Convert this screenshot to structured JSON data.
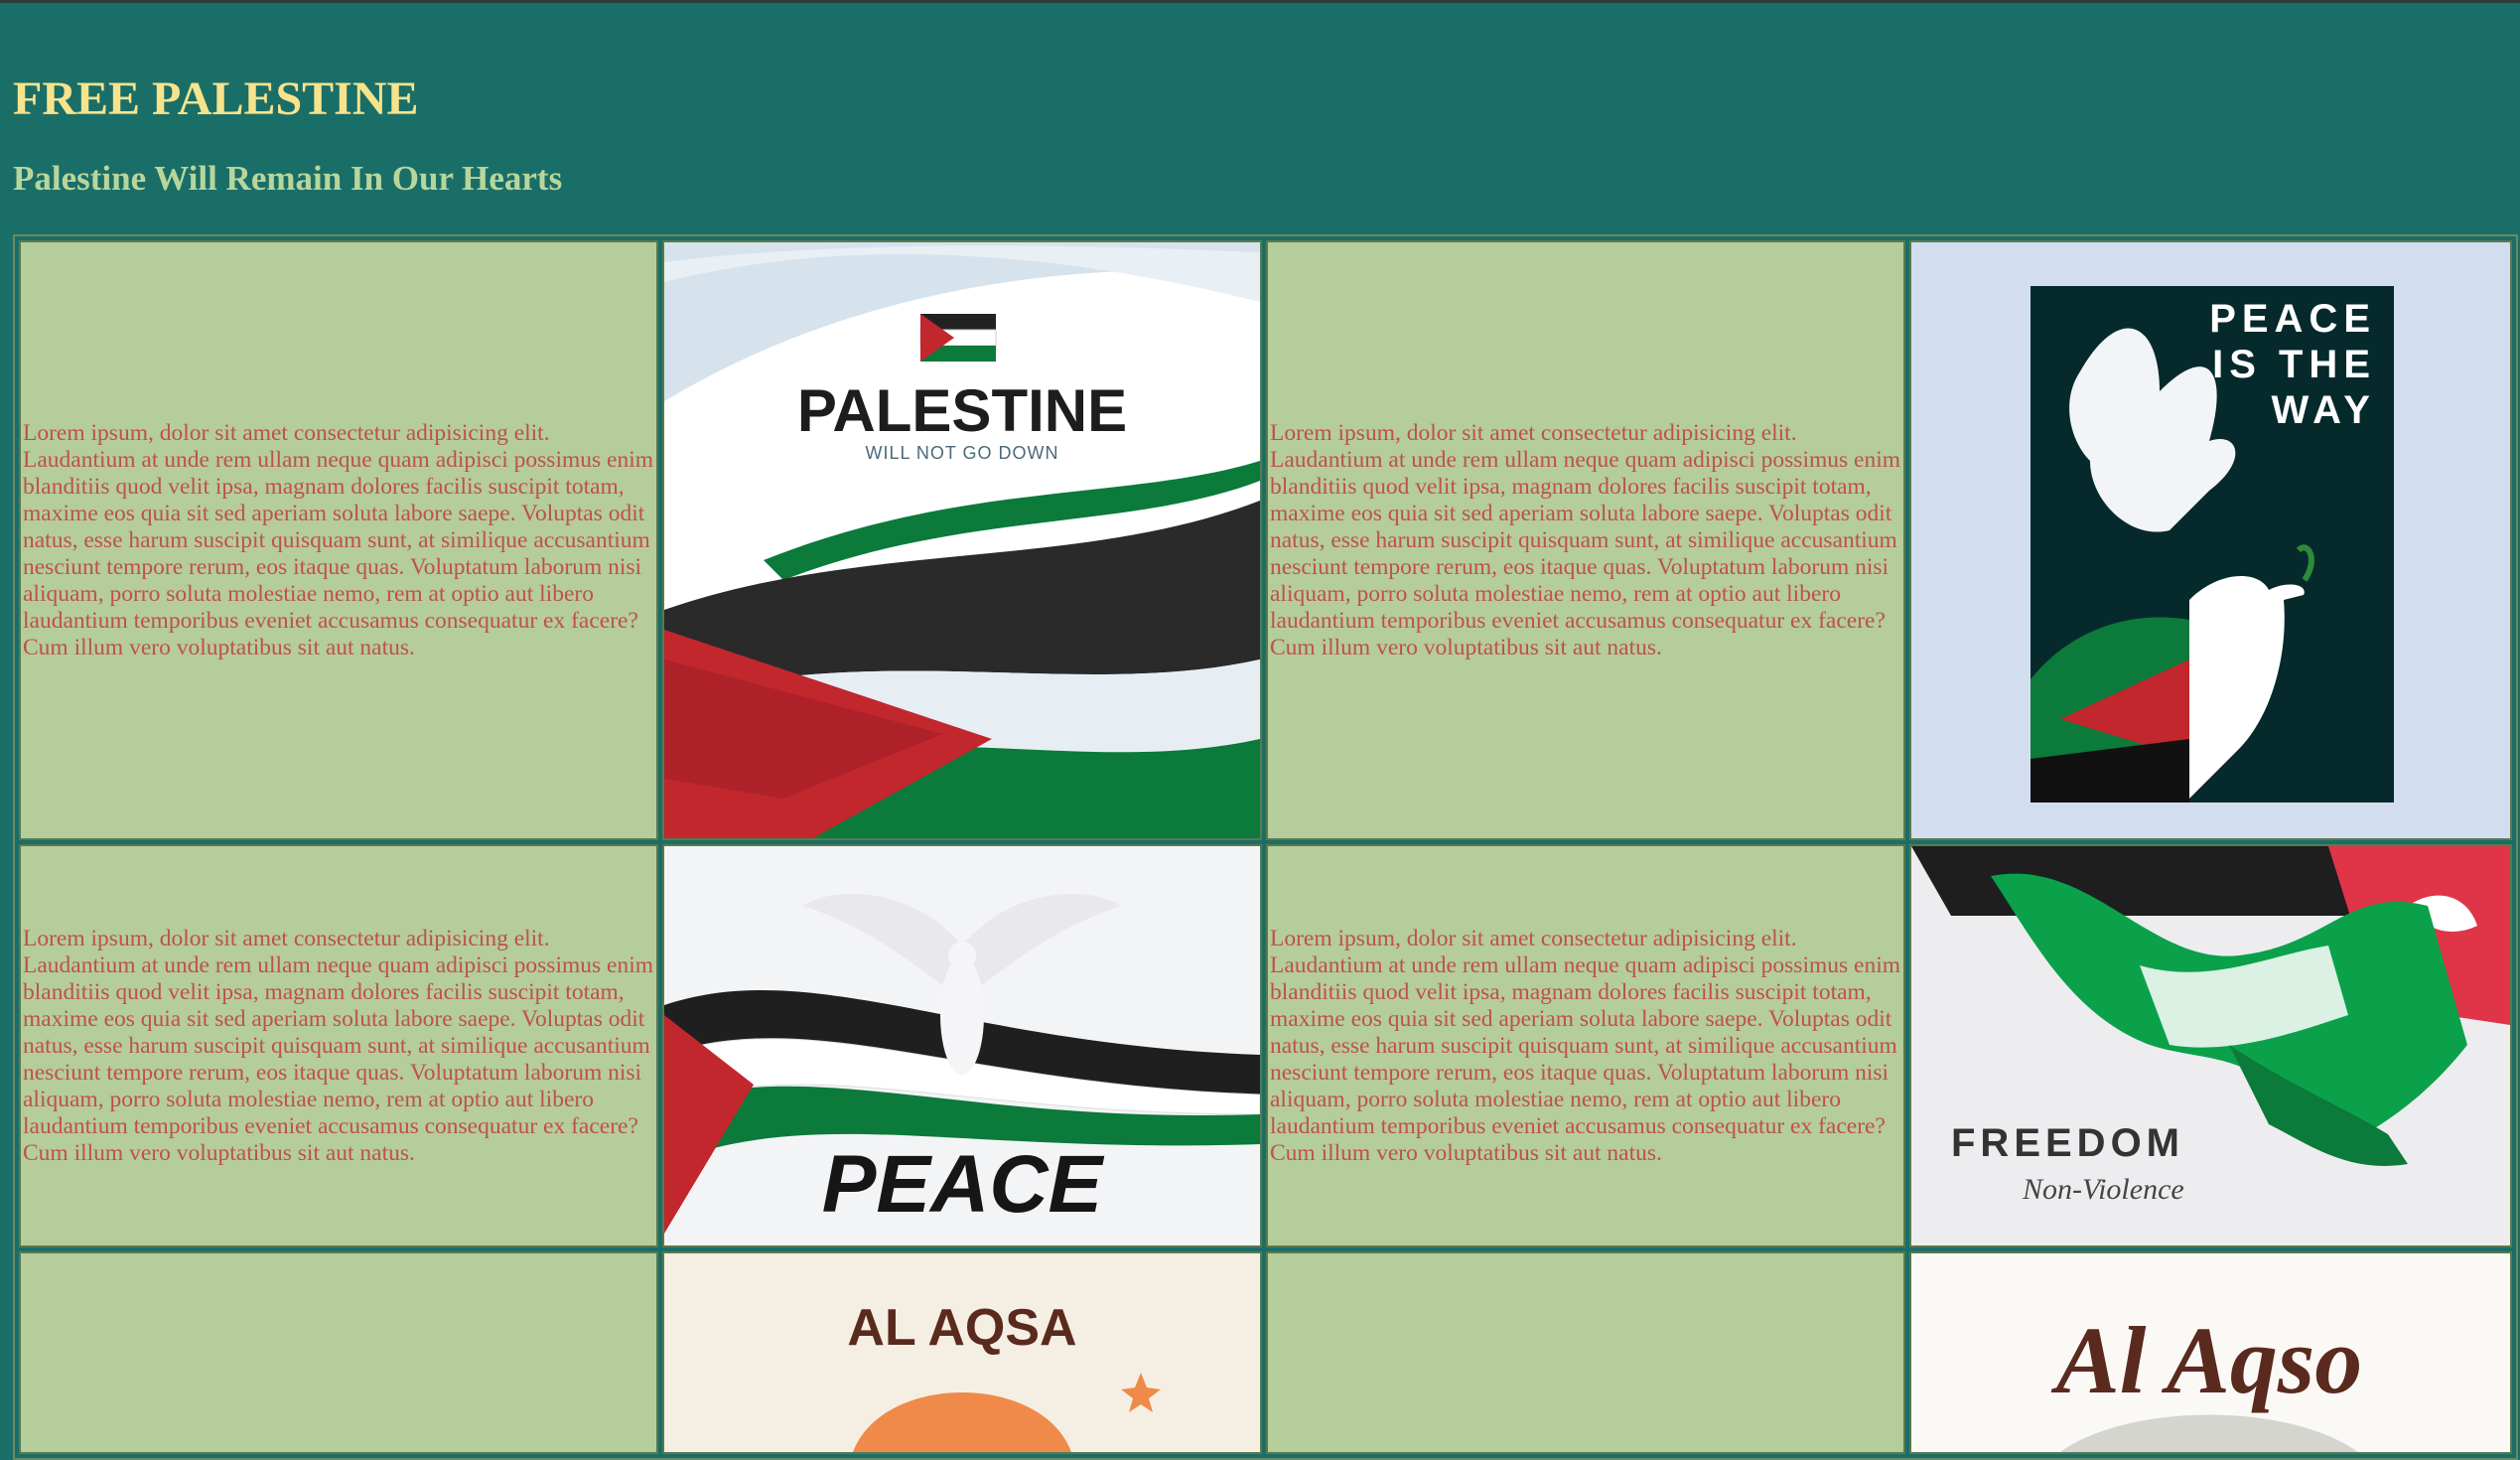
{
  "header": {
    "title": "FREE PALESTINE",
    "subtitle": "Palestine Will Remain In Our Hearts"
  },
  "lorem": "Lorem ipsum, dolor sit amet consectetur adipisicing elit. Laudantium at unde rem ullam neque quam adipisci possimus enim blanditiis quod velit ipsa, magnam dolores facilis suscipit totam, maxime eos quia sit sed aperiam soluta labore saepe. Voluptas odit natus, esse harum suscipit quisquam sunt, at similique accusantium nesciunt tempore rerum, eos itaque quas. Voluptatum laborum nisi aliquam, porro soluta molestiae nemo, rem at optio aut libero laudantium temporibus eveniet accusamus consequatur ex facere? Cum illum vero voluptatibus sit aut natus.",
  "posters": {
    "palestine": {
      "title": "PALESTINE",
      "tagline": "WILL NOT GO DOWN"
    },
    "peace_way": {
      "line1": "PEACE",
      "line2": "IS THE",
      "line3": "WAY"
    },
    "peace": {
      "title": "PEACE"
    },
    "freedom": {
      "title": "FREEDOM",
      "tagline": "Non-Violence"
    },
    "alaqsa1": {
      "title": "AL AQSA"
    },
    "alaqsa2": {
      "title": "Al Aqso"
    }
  },
  "colors": {
    "bg": "#1a6e68",
    "cell": "#b4cd9a",
    "title": "#f7e38c",
    "subtitle": "#b8d69b",
    "text": "#c0504a",
    "flag_red": "#c1272d",
    "flag_green": "#0b7a3a",
    "flag_black": "#222222"
  }
}
